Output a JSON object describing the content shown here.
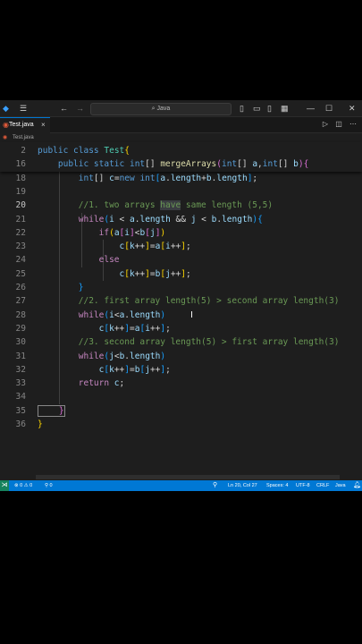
{
  "titlebar": {
    "search_text": "Java",
    "search_icon": "search-icon"
  },
  "tab": {
    "filename": "Test.java",
    "close_glyph": "×"
  },
  "breadcrumb": {
    "file": "Test.java"
  },
  "editor": {
    "lines": [
      {
        "n": "2",
        "tokens": [
          {
            "t": "public ",
            "c": "kw"
          },
          {
            "t": "class ",
            "c": "kw"
          },
          {
            "t": "Test",
            "c": "typ"
          },
          {
            "t": "{",
            "c": "br1"
          }
        ]
      },
      {
        "n": "16",
        "tokens": [
          {
            "t": "    public ",
            "c": "kw"
          },
          {
            "t": "static ",
            "c": "kw"
          },
          {
            "t": "int",
            "c": "kw"
          },
          {
            "t": "[] ",
            "c": ""
          },
          {
            "t": "mergeArrays",
            "c": "fn"
          },
          {
            "t": "(",
            "c": "br2"
          },
          {
            "t": "int",
            "c": "kw"
          },
          {
            "t": "[] ",
            "c": ""
          },
          {
            "t": "a",
            "c": "var"
          },
          {
            "t": ",",
            "c": ""
          },
          {
            "t": "int",
            "c": "kw"
          },
          {
            "t": "[] ",
            "c": ""
          },
          {
            "t": "b",
            "c": "var"
          },
          {
            "t": ")",
            "c": "br2"
          },
          {
            "t": "{",
            "c": "br2"
          }
        ]
      },
      {
        "n": "18",
        "tokens": [
          {
            "t": "        int",
            "c": "kw"
          },
          {
            "t": "[] ",
            "c": ""
          },
          {
            "t": "c",
            "c": "var"
          },
          {
            "t": "=",
            "c": ""
          },
          {
            "t": "new ",
            "c": "kw"
          },
          {
            "t": "int",
            "c": "kw"
          },
          {
            "t": "[",
            "c": "br3"
          },
          {
            "t": "a",
            "c": "var"
          },
          {
            "t": ".",
            "c": ""
          },
          {
            "t": "length",
            "c": "var"
          },
          {
            "t": "+",
            "c": ""
          },
          {
            "t": "b",
            "c": "var"
          },
          {
            "t": ".",
            "c": ""
          },
          {
            "t": "length",
            "c": "var"
          },
          {
            "t": "]",
            "c": "br3"
          },
          {
            "t": ";",
            "c": ""
          }
        ]
      },
      {
        "n": "19",
        "tokens": []
      },
      {
        "n": "20",
        "tokens": [
          {
            "t": "        //1. two arrays ",
            "c": "cmt"
          },
          {
            "t": "have",
            "c": "cmt hl"
          },
          {
            "t": " same length (5,5)",
            "c": "cmt"
          }
        ]
      },
      {
        "n": "21",
        "tokens": [
          {
            "t": "        while",
            "c": "ctl"
          },
          {
            "t": "(",
            "c": "br3"
          },
          {
            "t": "i",
            "c": "var"
          },
          {
            "t": " < ",
            "c": ""
          },
          {
            "t": "a",
            "c": "var"
          },
          {
            "t": ".",
            "c": ""
          },
          {
            "t": "length",
            "c": "var"
          },
          {
            "t": " && ",
            "c": ""
          },
          {
            "t": "j",
            "c": "var"
          },
          {
            "t": " < ",
            "c": ""
          },
          {
            "t": "b",
            "c": "var"
          },
          {
            "t": ".",
            "c": ""
          },
          {
            "t": "length",
            "c": "var"
          },
          {
            "t": ")",
            "c": "br3"
          },
          {
            "t": "{",
            "c": "br3"
          }
        ]
      },
      {
        "n": "22",
        "tokens": [
          {
            "t": "            if",
            "c": "ctl"
          },
          {
            "t": "(",
            "c": "br1"
          },
          {
            "t": "a",
            "c": "var"
          },
          {
            "t": "[",
            "c": "br2"
          },
          {
            "t": "i",
            "c": "var"
          },
          {
            "t": "]",
            "c": "br2"
          },
          {
            "t": "<",
            "c": ""
          },
          {
            "t": "b",
            "c": "var"
          },
          {
            "t": "[",
            "c": "br2"
          },
          {
            "t": "j",
            "c": "var"
          },
          {
            "t": "]",
            "c": "br2"
          },
          {
            "t": ")",
            "c": "br1"
          }
        ]
      },
      {
        "n": "23",
        "tokens": [
          {
            "t": "                c",
            "c": "var"
          },
          {
            "t": "[",
            "c": "br1"
          },
          {
            "t": "k",
            "c": "var"
          },
          {
            "t": "++",
            "c": ""
          },
          {
            "t": "]",
            "c": "br1"
          },
          {
            "t": "=",
            "c": ""
          },
          {
            "t": "a",
            "c": "var"
          },
          {
            "t": "[",
            "c": "br1"
          },
          {
            "t": "i",
            "c": "var"
          },
          {
            "t": "++",
            "c": ""
          },
          {
            "t": "]",
            "c": "br1"
          },
          {
            "t": ";",
            "c": ""
          }
        ]
      },
      {
        "n": "24",
        "tokens": [
          {
            "t": "            else",
            "c": "ctl"
          }
        ]
      },
      {
        "n": "25",
        "tokens": [
          {
            "t": "                c",
            "c": "var"
          },
          {
            "t": "[",
            "c": "br1"
          },
          {
            "t": "k",
            "c": "var"
          },
          {
            "t": "++",
            "c": ""
          },
          {
            "t": "]",
            "c": "br1"
          },
          {
            "t": "=",
            "c": ""
          },
          {
            "t": "b",
            "c": "var"
          },
          {
            "t": "[",
            "c": "br1"
          },
          {
            "t": "j",
            "c": "var"
          },
          {
            "t": "++",
            "c": ""
          },
          {
            "t": "]",
            "c": "br1"
          },
          {
            "t": ";",
            "c": ""
          }
        ]
      },
      {
        "n": "26",
        "tokens": [
          {
            "t": "        }",
            "c": "br3"
          }
        ]
      },
      {
        "n": "27",
        "tokens": [
          {
            "t": "        //2. first array length(5) > second array length(3)",
            "c": "cmt"
          }
        ]
      },
      {
        "n": "28",
        "tokens": [
          {
            "t": "        while",
            "c": "ctl"
          },
          {
            "t": "(",
            "c": "br3"
          },
          {
            "t": "i",
            "c": "var"
          },
          {
            "t": "<",
            "c": ""
          },
          {
            "t": "a",
            "c": "var"
          },
          {
            "t": ".",
            "c": ""
          },
          {
            "t": "length",
            "c": "var"
          },
          {
            "t": ")",
            "c": "br3"
          }
        ]
      },
      {
        "n": "29",
        "tokens": [
          {
            "t": "            c",
            "c": "var"
          },
          {
            "t": "[",
            "c": "br3"
          },
          {
            "t": "k",
            "c": "var"
          },
          {
            "t": "++",
            "c": ""
          },
          {
            "t": "]",
            "c": "br3"
          },
          {
            "t": "=",
            "c": ""
          },
          {
            "t": "a",
            "c": "var"
          },
          {
            "t": "[",
            "c": "br3"
          },
          {
            "t": "i",
            "c": "var"
          },
          {
            "t": "++",
            "c": ""
          },
          {
            "t": "]",
            "c": "br3"
          },
          {
            "t": ";",
            "c": ""
          }
        ]
      },
      {
        "n": "30",
        "tokens": [
          {
            "t": "        //3. second array length(5) > first array length(3)",
            "c": "cmt"
          }
        ]
      },
      {
        "n": "31",
        "tokens": [
          {
            "t": "        while",
            "c": "ctl"
          },
          {
            "t": "(",
            "c": "br3"
          },
          {
            "t": "j",
            "c": "var"
          },
          {
            "t": "<",
            "c": ""
          },
          {
            "t": "b",
            "c": "var"
          },
          {
            "t": ".",
            "c": ""
          },
          {
            "t": "length",
            "c": "var"
          },
          {
            "t": ")",
            "c": "br3"
          }
        ]
      },
      {
        "n": "32",
        "tokens": [
          {
            "t": "            c",
            "c": "var"
          },
          {
            "t": "[",
            "c": "br3"
          },
          {
            "t": "k",
            "c": "var"
          },
          {
            "t": "++",
            "c": ""
          },
          {
            "t": "]",
            "c": "br3"
          },
          {
            "t": "=",
            "c": ""
          },
          {
            "t": "b",
            "c": "var"
          },
          {
            "t": "[",
            "c": "br3"
          },
          {
            "t": "j",
            "c": "var"
          },
          {
            "t": "++",
            "c": ""
          },
          {
            "t": "]",
            "c": "br3"
          },
          {
            "t": ";",
            "c": ""
          }
        ]
      },
      {
        "n": "33",
        "tokens": [
          {
            "t": "        return ",
            "c": "ctl"
          },
          {
            "t": "c",
            "c": "var"
          },
          {
            "t": ";",
            "c": ""
          }
        ]
      },
      {
        "n": "34",
        "tokens": []
      },
      {
        "n": "35",
        "tokens": [
          {
            "t": "    }",
            "c": "br2 bracket-box"
          }
        ]
      },
      {
        "n": "36",
        "tokens": [
          {
            "t": "}",
            "c": "br1"
          }
        ]
      }
    ],
    "active_line": "20"
  },
  "statusbar": {
    "problems": "⊗ 0 ⚠ 0",
    "ports": "⚲ 0",
    "position": "Ln 20, Col 27",
    "spaces": "Spaces: 4",
    "encoding": "UTF-8",
    "eol": "CRLF",
    "language": "Java"
  },
  "colors": {
    "accent": "#0078d4",
    "editor_bg": "#1e1e1e",
    "titlebar_bg": "#1f1f1f"
  }
}
